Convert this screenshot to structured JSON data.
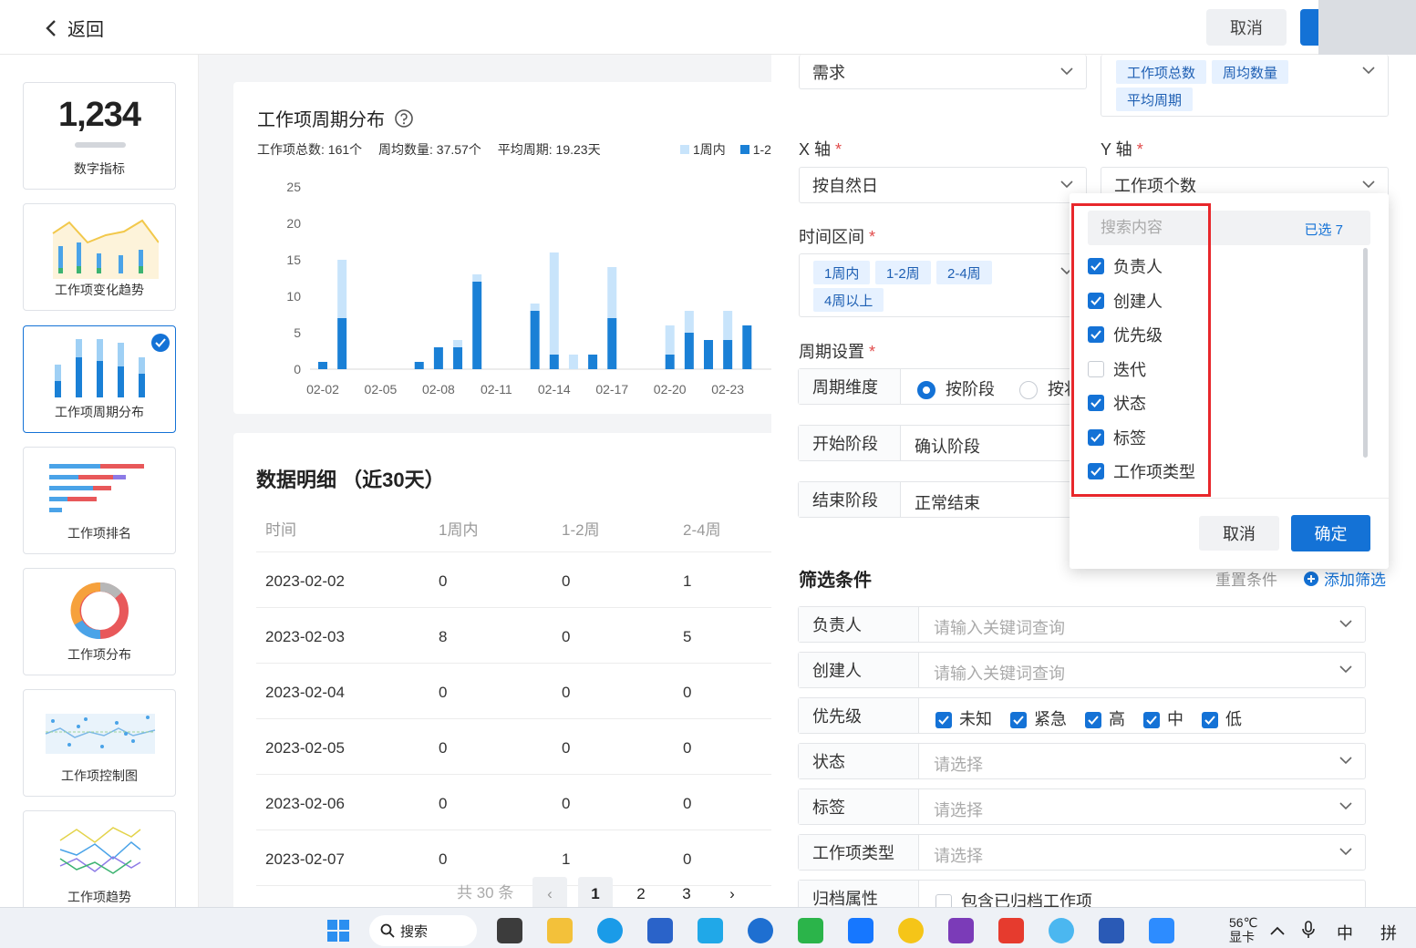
{
  "header": {
    "back_label": "返回",
    "cancel_label": "取消"
  },
  "sidebar": {
    "metric_value": "1,234",
    "cards": [
      {
        "label": "数字指标"
      },
      {
        "label": "工作项变化趋势"
      },
      {
        "label": "工作项周期分布"
      },
      {
        "label": "工作项排名"
      },
      {
        "label": "工作项分布"
      },
      {
        "label": "工作项控制图"
      },
      {
        "label": "工作项趋势"
      }
    ]
  },
  "chart_panel": {
    "title": "工作项周期分布",
    "stats": [
      "工作项总数: 161个",
      "周均数量: 37.57个",
      "平均周期: 19.23天"
    ],
    "legend": [
      "1周内",
      "1-2"
    ]
  },
  "chart_data": {
    "type": "bar",
    "stacked": true,
    "categories": [
      "02-02",
      "02-03",
      "02-04",
      "02-05",
      "02-06",
      "02-07",
      "02-08",
      "02-09",
      "02-10",
      "02-11",
      "02-12",
      "02-13",
      "02-14",
      "02-15",
      "02-16",
      "02-17",
      "02-18",
      "02-19",
      "02-20",
      "02-21",
      "02-22",
      "02-23",
      "02-24"
    ],
    "x_tick_labels": [
      "02-02",
      "02-05",
      "02-08",
      "02-11",
      "02-14",
      "02-17",
      "02-20",
      "02-23"
    ],
    "series": [
      {
        "name": "1周内",
        "color": "#c8e4fb",
        "values": [
          0,
          8,
          0,
          0,
          0,
          0,
          0,
          1,
          1,
          0,
          0,
          1,
          14,
          2,
          0,
          7,
          0,
          0,
          4,
          3,
          0,
          4,
          0
        ]
      },
      {
        "name": "1-2",
        "color": "#1a80d6",
        "values": [
          1,
          7,
          0,
          0,
          0,
          1,
          3,
          3,
          12,
          0,
          0,
          8,
          2,
          0,
          2,
          7,
          0,
          0,
          2,
          5,
          4,
          4,
          6
        ]
      }
    ],
    "y_ticks": [
      "25",
      "20",
      "15",
      "10",
      "5",
      "0"
    ],
    "ylim": [
      0,
      25
    ],
    "colors": {
      "dark": "#1a80d6",
      "light": "#c8e4fb"
    }
  },
  "detail": {
    "title": "数据明细  （近30天）",
    "columns": [
      "时间",
      "1周内",
      "1-2周",
      "2-4周"
    ],
    "rows": [
      [
        "2023-02-02",
        "0",
        "0",
        "1"
      ],
      [
        "2023-02-03",
        "8",
        "0",
        "5"
      ],
      [
        "2023-02-04",
        "0",
        "0",
        "0"
      ],
      [
        "2023-02-05",
        "0",
        "0",
        "0"
      ],
      [
        "2023-02-06",
        "0",
        "0",
        "0"
      ],
      [
        "2023-02-07",
        "0",
        "1",
        "0"
      ]
    ],
    "total": "共 30 条",
    "pages": [
      "1",
      "2",
      "3"
    ],
    "next": "›",
    "prev": "‹"
  },
  "config": {
    "type_value": "需求",
    "y_metric_tags": [
      "工作项总数",
      "周均数量",
      "平均周期"
    ],
    "x_axis_label": "X 轴",
    "y_axis_label": "Y 轴",
    "x_axis_value": "按自然日",
    "y_axis_value": "工作项个数",
    "time_range_label": "时间区间",
    "time_range_tags": [
      "1周内",
      "1-2周",
      "2-4周",
      "4周以上"
    ],
    "period_label": "周期设置",
    "period_dimension_label": "周期维度",
    "radio_stage": "按阶段",
    "radio_other": "按状",
    "start_stage_label": "开始阶段",
    "start_stage_value": "确认阶段",
    "end_stage_label": "结束阶段",
    "end_stage_value": "正常结束",
    "required_mark": "*"
  },
  "filters": {
    "title": "筛选条件",
    "reset": "重置条件",
    "add": "添加筛选",
    "rows": [
      {
        "key": "负责人",
        "placeholder": "请输入关键词查询"
      },
      {
        "key": "创建人",
        "placeholder": "请输入关键词查询"
      },
      {
        "key": "优先级",
        "options": [
          "未知",
          "紧急",
          "高",
          "中",
          "低"
        ]
      },
      {
        "key": "状态",
        "placeholder": "请选择"
      },
      {
        "key": "标签",
        "placeholder": "请选择"
      },
      {
        "key": "工作项类型",
        "placeholder": "请选择"
      },
      {
        "key": "归档属性",
        "checkbox_label": "包含已归档工作项"
      }
    ]
  },
  "dropdown": {
    "search_placeholder": "搜索内容",
    "selected_count": "已选 7",
    "options": [
      {
        "label": "负责人",
        "checked": true
      },
      {
        "label": "创建人",
        "checked": true
      },
      {
        "label": "优先级",
        "checked": true
      },
      {
        "label": "迭代",
        "checked": false
      },
      {
        "label": "状态",
        "checked": true
      },
      {
        "label": "标签",
        "checked": true
      },
      {
        "label": "工作项类型",
        "checked": true
      }
    ],
    "cancel": "取消",
    "ok": "确定"
  },
  "taskbar": {
    "search_label": "搜索",
    "weather_temp": "56℃",
    "weather_desc": "显卡",
    "ime1": "中",
    "ime2": "拼"
  }
}
